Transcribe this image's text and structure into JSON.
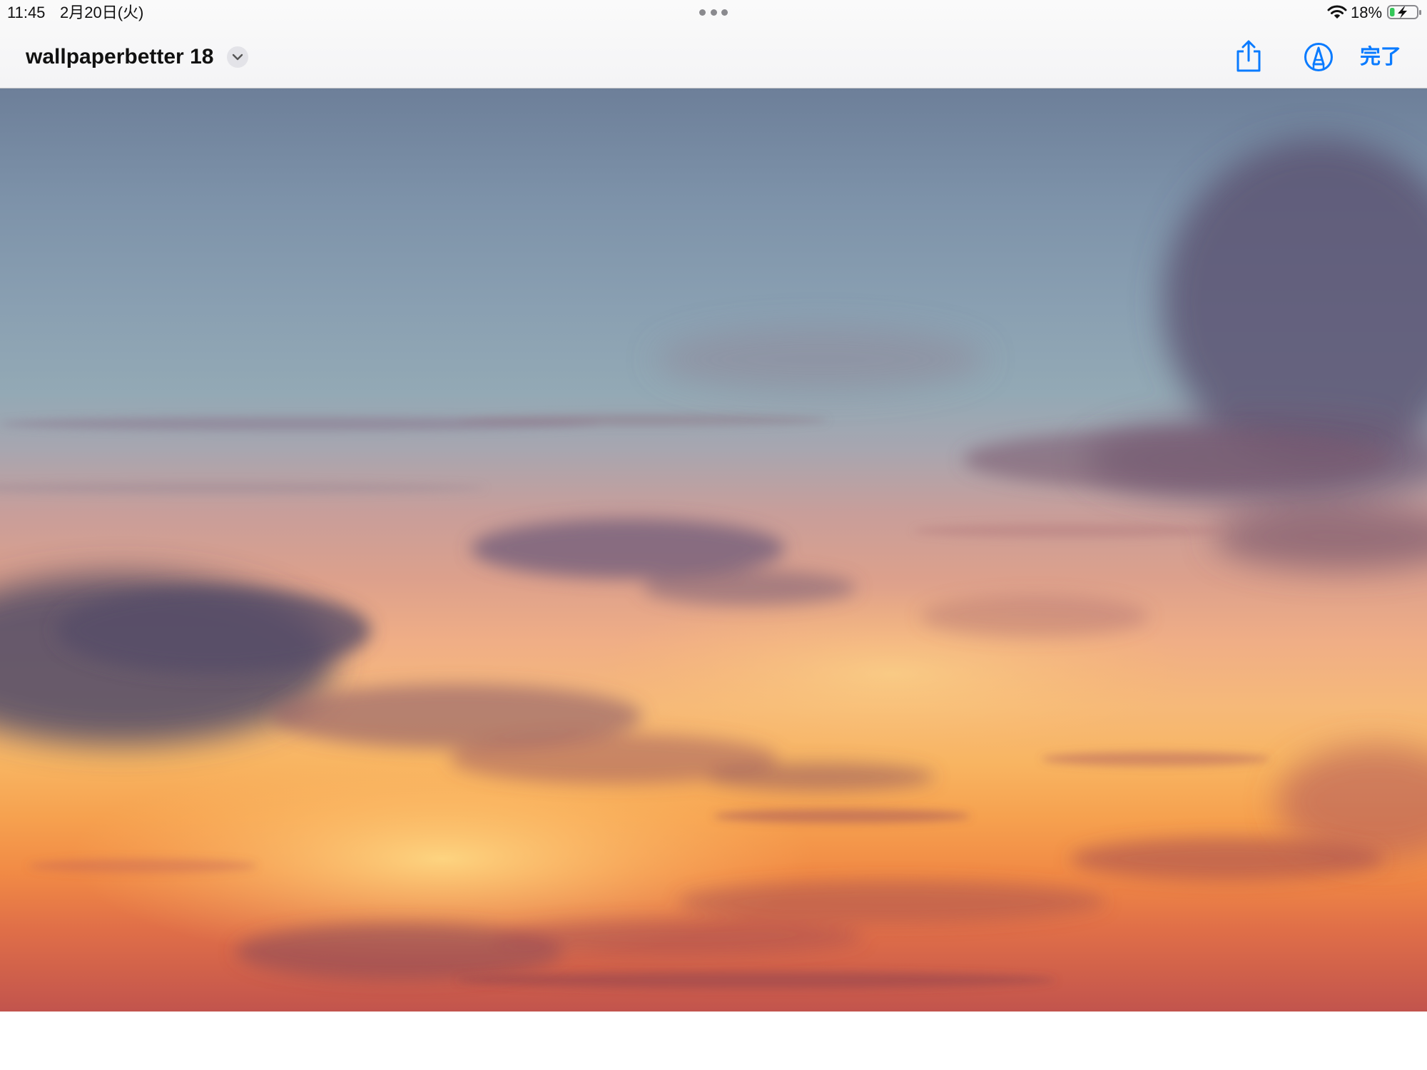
{
  "status_bar": {
    "time": "11:45",
    "date": "2月20日(火)",
    "battery_percent": "18%",
    "battery_level": 0.18,
    "charging": true,
    "wifi_icon": "wifi-icon",
    "battery_icon": "battery-charging-icon"
  },
  "nav_bar": {
    "title": "wallpaperbetter 18",
    "title_menu_icon": "chevron-down-icon",
    "share_icon": "share-icon",
    "markup_icon": "markup-pen-icon",
    "done_label": "完了"
  },
  "colors": {
    "accent": "#0a7bff",
    "bar_background": "#f7f7f8"
  }
}
